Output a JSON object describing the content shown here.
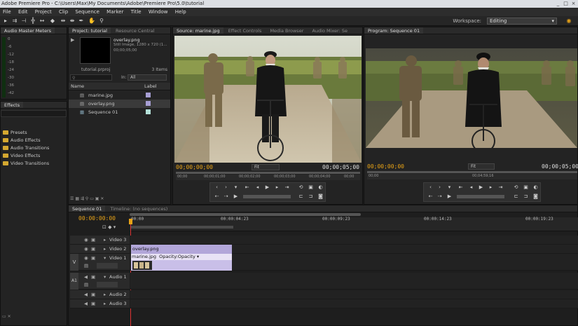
{
  "window": {
    "title": "Adobe Premiere Pro - C:\\Users\\Max\\My Documents\\Adobe\\Premiere Pro\\5.0\\tutorial",
    "minimize": "_",
    "maximize": "□",
    "close": "×"
  },
  "menu": [
    "File",
    "Edit",
    "Project",
    "Clip",
    "Sequence",
    "Marker",
    "Title",
    "Window",
    "Help"
  ],
  "toolbar": {
    "workspace_label": "Workspace:",
    "workspace_value": "Editing"
  },
  "audio_meters": {
    "tab": "Audio Master Meters",
    "scale": [
      "0",
      "-6",
      "-12",
      "-18",
      "-24",
      "-30",
      "-36",
      "-42"
    ]
  },
  "project": {
    "tabs": [
      "Project: tutorial",
      "Resource Central"
    ],
    "preview_name": "overlay.png",
    "preview_info1": "Still Image, 1280 x 720 (1...",
    "preview_info2": "00;00;05;00",
    "project_file": "tutorial.prproj",
    "item_count": "3 Items",
    "in_label": "In:",
    "in_value": "All",
    "col_name": "Name",
    "col_label": "Label",
    "items": [
      {
        "name": "marine.jpg",
        "color": "#a79fd4"
      },
      {
        "name": "overlay.png",
        "color": "#a79fd4"
      },
      {
        "name": "Sequence 01",
        "color": "#b4e0d8"
      }
    ]
  },
  "effects": {
    "tab": "Effects",
    "folders": [
      "Presets",
      "Audio Effects",
      "Audio Transitions",
      "Video Effects",
      "Video Transitions"
    ]
  },
  "source_monitor": {
    "tabs": [
      "Source: marine.jpg",
      "Effect Controls",
      "Media Browser",
      "Audio Mixer: Se"
    ],
    "tc_left": "00;00;00;00",
    "fit": "Fit",
    "tc_right": "00;00;05;00",
    "ruler": [
      "00;00",
      "00;00;01;00",
      "00;00;02;00",
      "00;00;03;00",
      "00;00;04;00",
      "00;00"
    ]
  },
  "program_monitor": {
    "tabs": [
      "Program: Sequence 01"
    ],
    "tc_left": "00;00;00;00",
    "fit": "Fit",
    "tc_right": "00;00;05;00",
    "ruler": [
      "00;00",
      "00;04;59;16"
    ]
  },
  "timeline": {
    "tabs": [
      "Sequence 01",
      "Timeline: (no sequences)"
    ],
    "timecode": "00:00:00:00",
    "ruler": [
      "00:00",
      "00:00:04:23",
      "00:00:09:23",
      "00:00:14:23",
      "00:00:19:23"
    ],
    "tracks": {
      "v3": "Video 3",
      "v2": "Video 2",
      "v1": "Video 1",
      "a1": "Audio 1",
      "a2": "Audio 2",
      "a3": "Audio 3"
    },
    "v_target": "V",
    "a_target": "A1",
    "clip_overlay": "overlay.png",
    "clip_marine": "marine.jpg",
    "clip_opacity": "Opacity:Opacity ▾"
  }
}
